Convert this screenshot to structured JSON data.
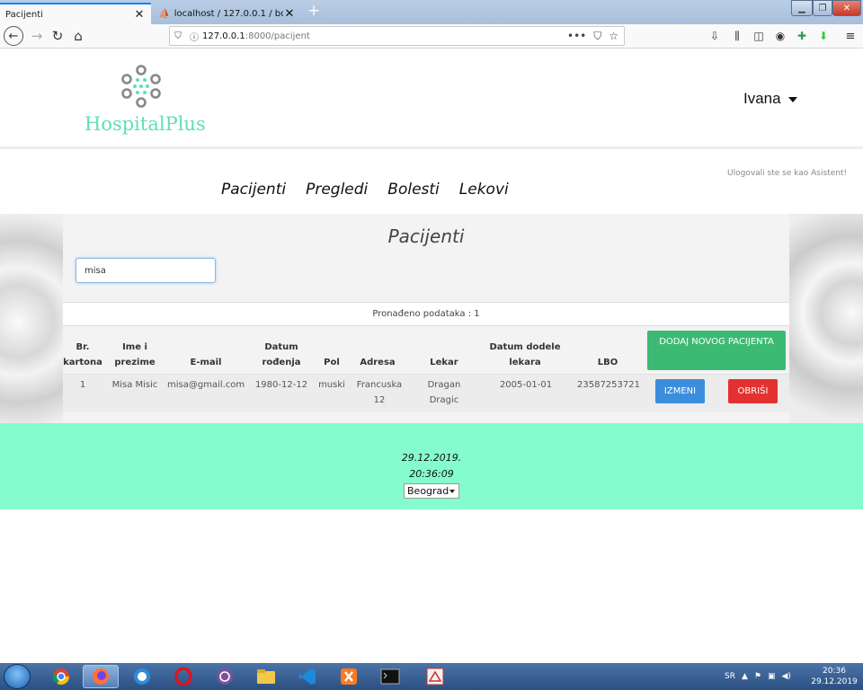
{
  "browser": {
    "tabs": [
      {
        "label": "Pacijenti",
        "close": "✕"
      },
      {
        "label": "localhost / 127.0.0.1 / bolnica /",
        "close": "✕"
      }
    ],
    "new_tab": "+",
    "url_host": "127.0.0.1",
    "url_rest": ":8000/pacijent",
    "url_more": "•••"
  },
  "site": {
    "brand": "HospitalPlus",
    "user": "Ivana",
    "menu": [
      "Pacijenti",
      "Pregledi",
      "Bolesti",
      "Lekovi"
    ],
    "login_info": "Ulogovali ste se kao Asistent!",
    "accent_color": "#5fe0b4"
  },
  "main": {
    "title": "Pacijenti",
    "search_value": "misa",
    "found_text": "Pronađeno podataka : 1",
    "columns": [
      "Br. kartona",
      "Ime i prezime",
      "E-mail",
      "Datum rođenja",
      "Pol",
      "Adresa",
      "Lekar",
      "Datum dodele lekara",
      "LBO"
    ],
    "add_button": "DODAJ NOVOG PACIJENTA",
    "rows": [
      {
        "br": "1",
        "ime": "Misa Misic",
        "email": "misa@gmail.com",
        "datum": "1980-12-12",
        "pol": "muski",
        "adresa": "Francuska 12",
        "lekar": "Dragan Dragic",
        "dodela": "2005-01-01",
        "lbo": "23587253721",
        "edit": "IZMENI",
        "delete": "OBRIŠI"
      }
    ]
  },
  "footer": {
    "date": "29.12.2019.",
    "time": "20:36:09",
    "city": "Beograd",
    "color": "#84fccd"
  },
  "taskbar": {
    "lang": "SR",
    "time": "20:36",
    "date": "29.12.2019"
  }
}
